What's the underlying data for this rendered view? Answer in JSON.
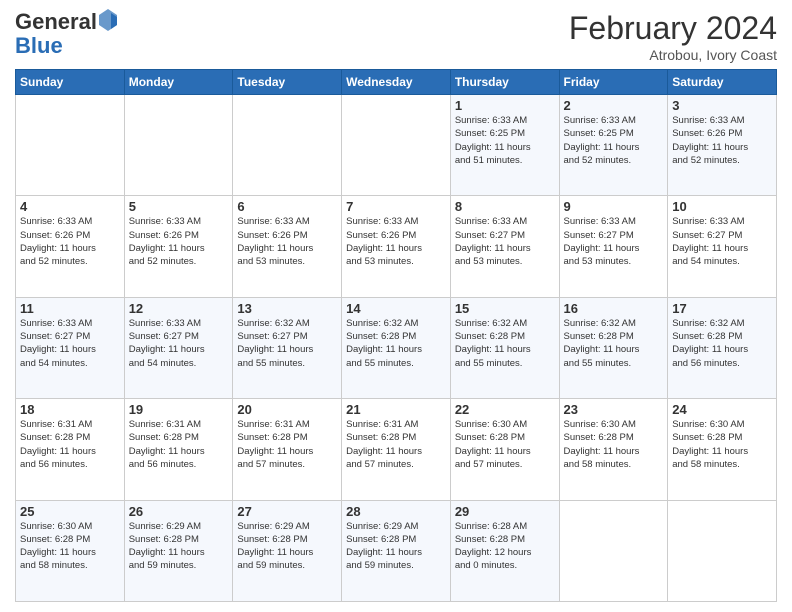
{
  "header": {
    "logo_general": "General",
    "logo_blue": "Blue",
    "month_title": "February 2024",
    "location": "Atrobou, Ivory Coast"
  },
  "days_of_week": [
    "Sunday",
    "Monday",
    "Tuesday",
    "Wednesday",
    "Thursday",
    "Friday",
    "Saturday"
  ],
  "weeks": [
    [
      {
        "num": "",
        "info": ""
      },
      {
        "num": "",
        "info": ""
      },
      {
        "num": "",
        "info": ""
      },
      {
        "num": "",
        "info": ""
      },
      {
        "num": "1",
        "info": "Sunrise: 6:33 AM\nSunset: 6:25 PM\nDaylight: 11 hours\nand 51 minutes."
      },
      {
        "num": "2",
        "info": "Sunrise: 6:33 AM\nSunset: 6:25 PM\nDaylight: 11 hours\nand 52 minutes."
      },
      {
        "num": "3",
        "info": "Sunrise: 6:33 AM\nSunset: 6:26 PM\nDaylight: 11 hours\nand 52 minutes."
      }
    ],
    [
      {
        "num": "4",
        "info": "Sunrise: 6:33 AM\nSunset: 6:26 PM\nDaylight: 11 hours\nand 52 minutes."
      },
      {
        "num": "5",
        "info": "Sunrise: 6:33 AM\nSunset: 6:26 PM\nDaylight: 11 hours\nand 52 minutes."
      },
      {
        "num": "6",
        "info": "Sunrise: 6:33 AM\nSunset: 6:26 PM\nDaylight: 11 hours\nand 53 minutes."
      },
      {
        "num": "7",
        "info": "Sunrise: 6:33 AM\nSunset: 6:26 PM\nDaylight: 11 hours\nand 53 minutes."
      },
      {
        "num": "8",
        "info": "Sunrise: 6:33 AM\nSunset: 6:27 PM\nDaylight: 11 hours\nand 53 minutes."
      },
      {
        "num": "9",
        "info": "Sunrise: 6:33 AM\nSunset: 6:27 PM\nDaylight: 11 hours\nand 53 minutes."
      },
      {
        "num": "10",
        "info": "Sunrise: 6:33 AM\nSunset: 6:27 PM\nDaylight: 11 hours\nand 54 minutes."
      }
    ],
    [
      {
        "num": "11",
        "info": "Sunrise: 6:33 AM\nSunset: 6:27 PM\nDaylight: 11 hours\nand 54 minutes."
      },
      {
        "num": "12",
        "info": "Sunrise: 6:33 AM\nSunset: 6:27 PM\nDaylight: 11 hours\nand 54 minutes."
      },
      {
        "num": "13",
        "info": "Sunrise: 6:32 AM\nSunset: 6:27 PM\nDaylight: 11 hours\nand 55 minutes."
      },
      {
        "num": "14",
        "info": "Sunrise: 6:32 AM\nSunset: 6:28 PM\nDaylight: 11 hours\nand 55 minutes."
      },
      {
        "num": "15",
        "info": "Sunrise: 6:32 AM\nSunset: 6:28 PM\nDaylight: 11 hours\nand 55 minutes."
      },
      {
        "num": "16",
        "info": "Sunrise: 6:32 AM\nSunset: 6:28 PM\nDaylight: 11 hours\nand 55 minutes."
      },
      {
        "num": "17",
        "info": "Sunrise: 6:32 AM\nSunset: 6:28 PM\nDaylight: 11 hours\nand 56 minutes."
      }
    ],
    [
      {
        "num": "18",
        "info": "Sunrise: 6:31 AM\nSunset: 6:28 PM\nDaylight: 11 hours\nand 56 minutes."
      },
      {
        "num": "19",
        "info": "Sunrise: 6:31 AM\nSunset: 6:28 PM\nDaylight: 11 hours\nand 56 minutes."
      },
      {
        "num": "20",
        "info": "Sunrise: 6:31 AM\nSunset: 6:28 PM\nDaylight: 11 hours\nand 57 minutes."
      },
      {
        "num": "21",
        "info": "Sunrise: 6:31 AM\nSunset: 6:28 PM\nDaylight: 11 hours\nand 57 minutes."
      },
      {
        "num": "22",
        "info": "Sunrise: 6:30 AM\nSunset: 6:28 PM\nDaylight: 11 hours\nand 57 minutes."
      },
      {
        "num": "23",
        "info": "Sunrise: 6:30 AM\nSunset: 6:28 PM\nDaylight: 11 hours\nand 58 minutes."
      },
      {
        "num": "24",
        "info": "Sunrise: 6:30 AM\nSunset: 6:28 PM\nDaylight: 11 hours\nand 58 minutes."
      }
    ],
    [
      {
        "num": "25",
        "info": "Sunrise: 6:30 AM\nSunset: 6:28 PM\nDaylight: 11 hours\nand 58 minutes."
      },
      {
        "num": "26",
        "info": "Sunrise: 6:29 AM\nSunset: 6:28 PM\nDaylight: 11 hours\nand 59 minutes."
      },
      {
        "num": "27",
        "info": "Sunrise: 6:29 AM\nSunset: 6:28 PM\nDaylight: 11 hours\nand 59 minutes."
      },
      {
        "num": "28",
        "info": "Sunrise: 6:29 AM\nSunset: 6:28 PM\nDaylight: 11 hours\nand 59 minutes."
      },
      {
        "num": "29",
        "info": "Sunrise: 6:28 AM\nSunset: 6:28 PM\nDaylight: 12 hours\nand 0 minutes."
      },
      {
        "num": "",
        "info": ""
      },
      {
        "num": "",
        "info": ""
      }
    ]
  ]
}
